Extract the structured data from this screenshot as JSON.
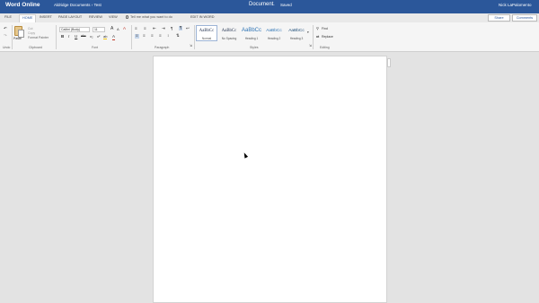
{
  "title_bar": {
    "app_name": "Word Online",
    "breadcrumb": "Aldridge Documents › Test",
    "document": "Document",
    "separator": "–",
    "save_status": "Saved",
    "user": "Nick LaPalomento"
  },
  "menu": {
    "tabs": [
      "FILE",
      "HOME",
      "INSERT",
      "PAGE LAYOUT",
      "REVIEW",
      "VIEW"
    ],
    "active_tab": "HOME",
    "tell_me": "Tell me what you want to do",
    "edit_in_word": "EDIT IN WORD",
    "share": "Share",
    "comments": "Comments"
  },
  "ribbon": {
    "undo": {
      "label": "Undo"
    },
    "clipboard": {
      "label": "Clipboard",
      "paste": "Paste",
      "cut": "Cut",
      "copy": "Copy",
      "format_painter": "Format Painter"
    },
    "font": {
      "label": "Font",
      "name": "Calibri (Body)",
      "size": "11",
      "bold": "B",
      "italic": "I",
      "underline": "U",
      "strike": "abc",
      "subscript": "x₂",
      "superscript": "x²",
      "grow": "A",
      "shrink": "A",
      "clear": "A",
      "color": "A",
      "highlight": "ab"
    },
    "paragraph": {
      "label": "Paragraph"
    },
    "styles": {
      "label": "Styles",
      "items": [
        {
          "sample": "AaBbCc",
          "name": "Normal"
        },
        {
          "sample": "AaBbCc",
          "name": "No Spacing"
        },
        {
          "sample": "AaBbCc",
          "name": "Heading 1"
        },
        {
          "sample": "AaBbCc",
          "name": "Heading 2"
        },
        {
          "sample": "AaBbCc",
          "name": "Heading 3"
        }
      ]
    },
    "editing": {
      "label": "Editing",
      "find": "Find",
      "replace": "Replace"
    }
  },
  "colors": {
    "brand": "#2b579a",
    "workspace": "#e3e3e3"
  }
}
